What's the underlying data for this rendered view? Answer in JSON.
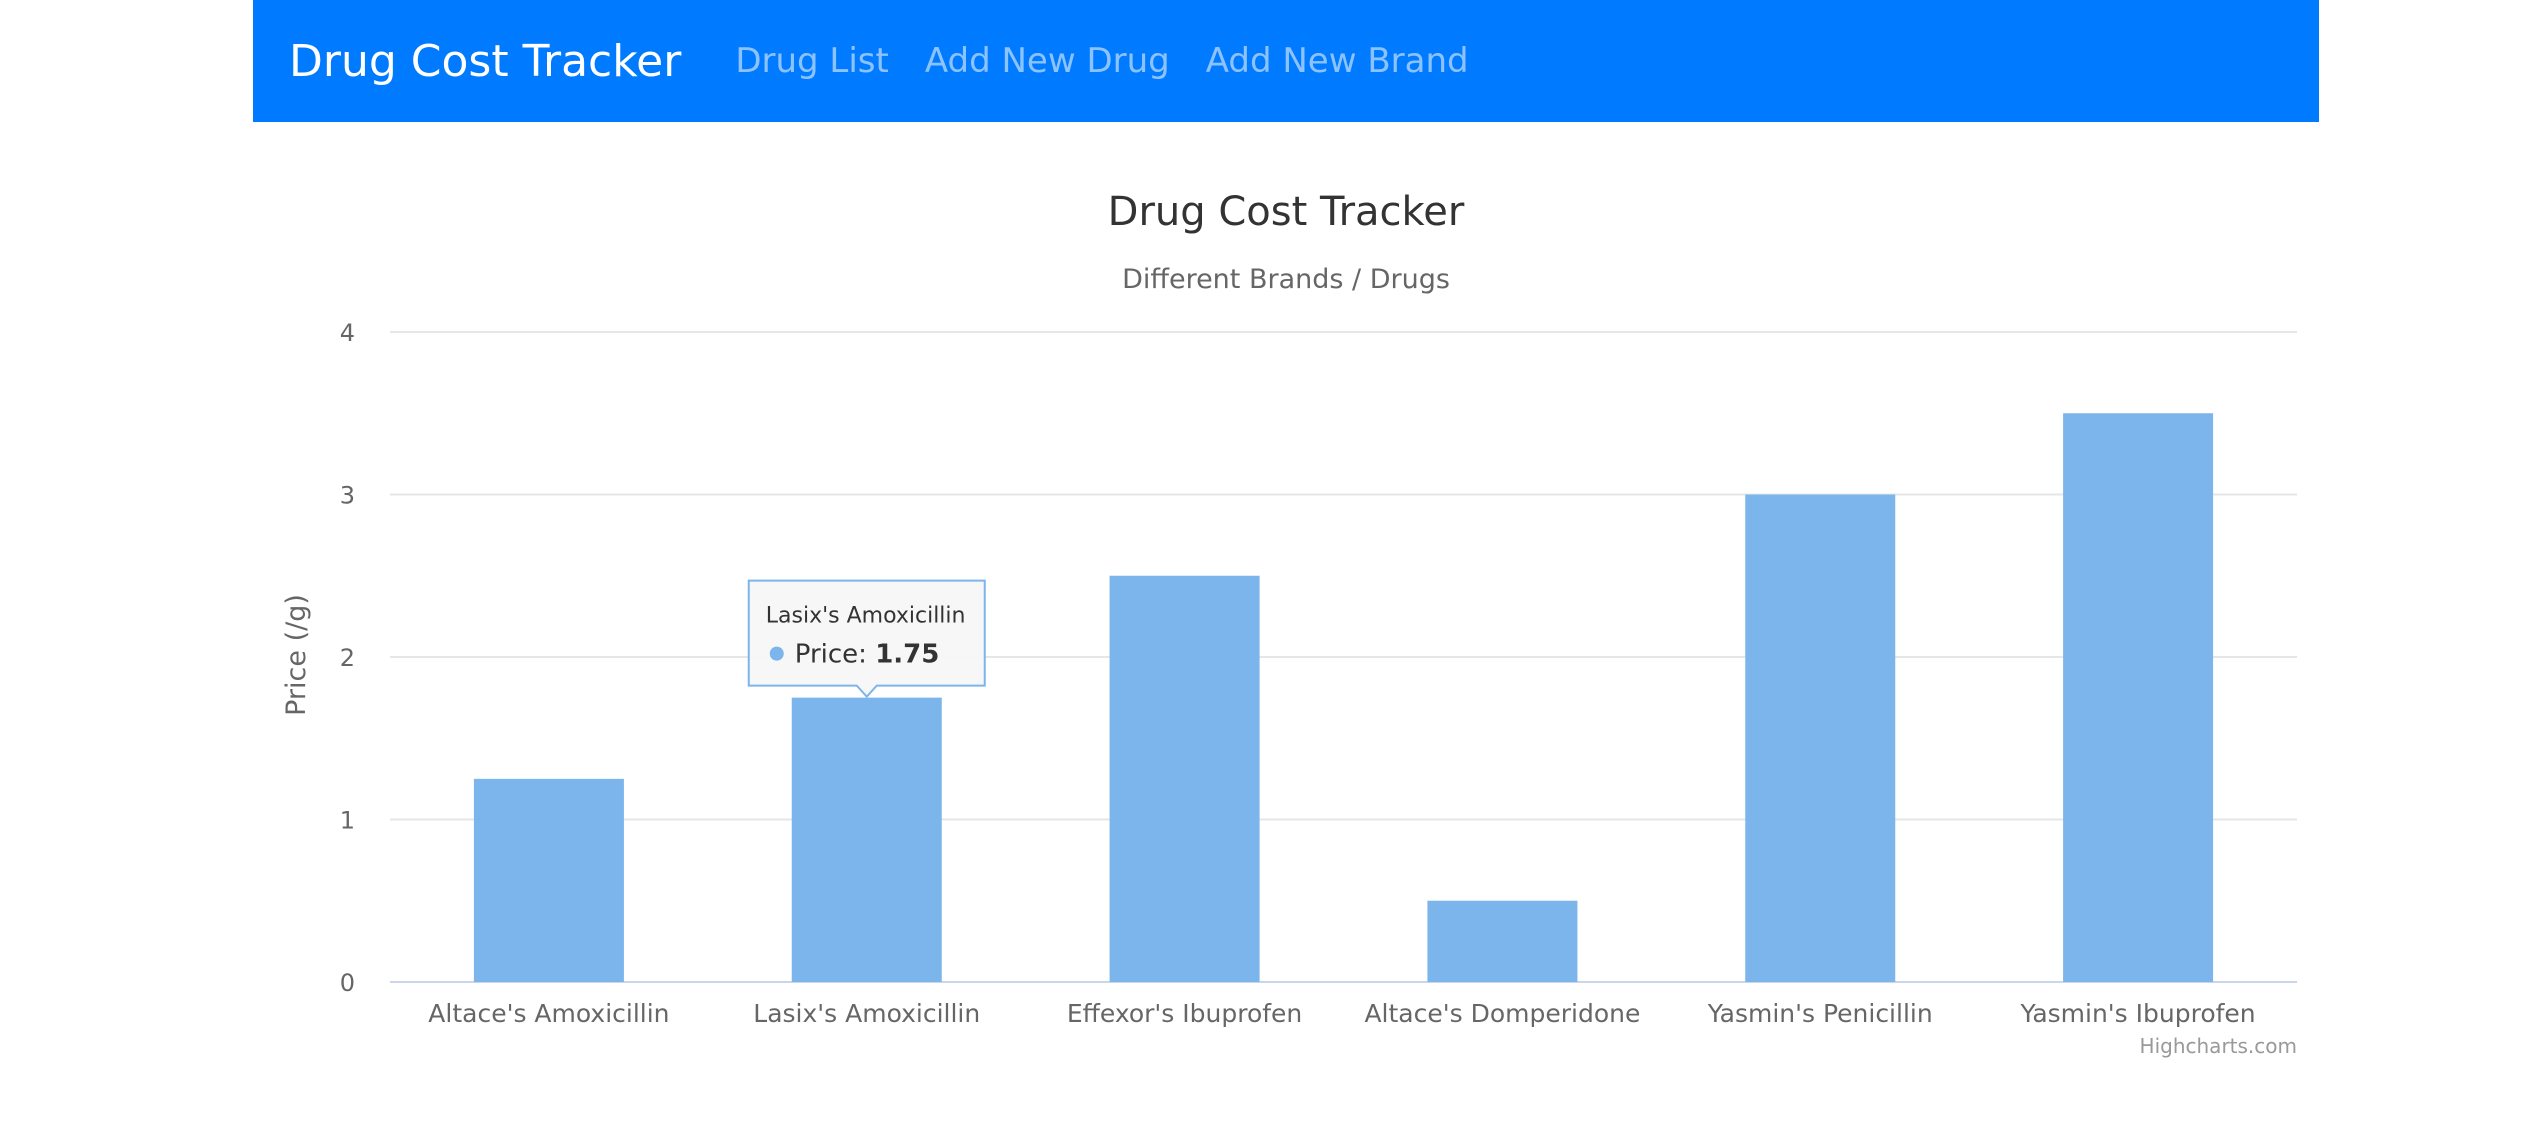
{
  "navbar": {
    "brand": "Drug Cost Tracker",
    "links": [
      "Drug List",
      "Add New Drug",
      "Add New Brand"
    ],
    "bg_color": "#007bff"
  },
  "chart_data": {
    "type": "bar",
    "title": "Drug Cost Tracker",
    "subtitle": "Different Brands / Drugs",
    "ylabel": "Price (/g)",
    "xlabel": "",
    "categories": [
      "Altace's Amoxicillin",
      "Lasix's Amoxicillin",
      "Effexor's Ibuprofen",
      "Altace's Domperidone",
      "Yasmin's Penicillin",
      "Yasmin's Ibuprofen"
    ],
    "series": [
      {
        "name": "Price",
        "values": [
          1.25,
          1.75,
          2.5,
          0.5,
          3.0,
          3.5
        ],
        "color": "#7cb5ec"
      }
    ],
    "ylim": [
      0,
      4
    ],
    "yticks": [
      0,
      1,
      2,
      3,
      4
    ],
    "grid": true,
    "legend": "none",
    "credits": "Highcharts.com",
    "tooltip": {
      "category": "Lasix's Amoxicillin",
      "label": "Price",
      "value": "1.75",
      "index": 1
    }
  }
}
